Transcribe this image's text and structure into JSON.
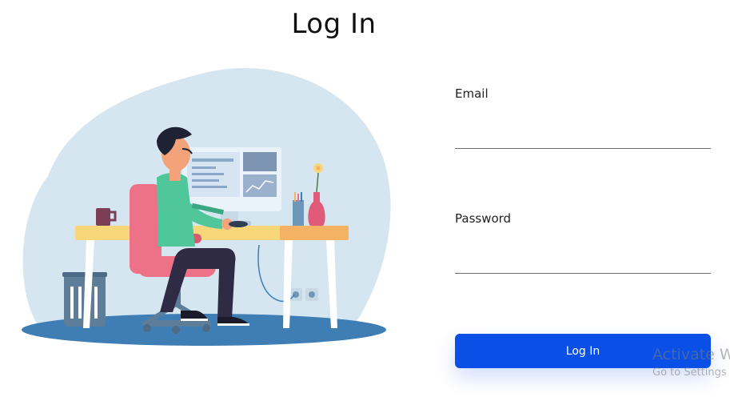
{
  "page": {
    "title": "Log In"
  },
  "form": {
    "email_label": "Email",
    "email_value": "",
    "password_label": "Password",
    "password_value": "",
    "submit_label": "Log In"
  },
  "os_watermark": {
    "line1": "Activate Wi",
    "line2": "Go to Settings"
  },
  "colors": {
    "accent": "#0a50e6",
    "blob": "#d5e6f1",
    "floor": "#3f7eb4",
    "chair": "#ee7287",
    "desk": "#f7d77a"
  }
}
